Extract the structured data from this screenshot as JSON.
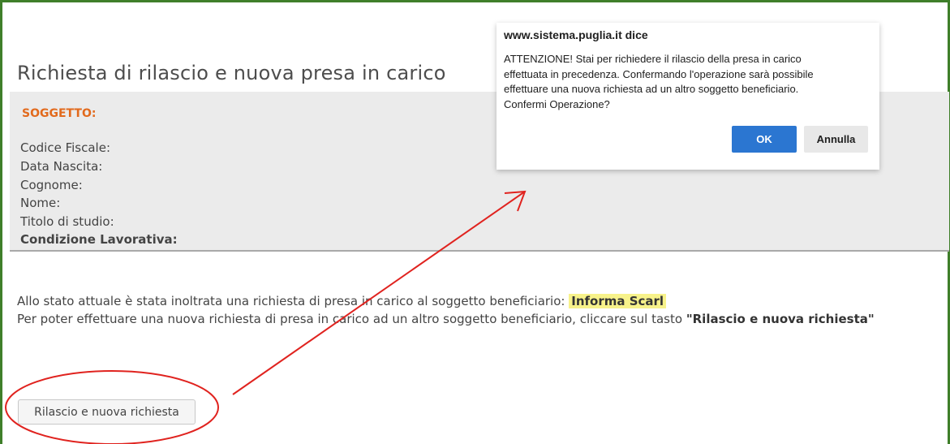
{
  "page": {
    "title": "Richiesta di rilascio e nuova presa in carico"
  },
  "soggetto": {
    "header": "SOGGETTO:",
    "fields": [
      "Codice Fiscale:",
      "Data Nascita:",
      "Cognome:",
      "Nome:",
      "Titolo di studio:",
      "Condizione Lavorativa:"
    ]
  },
  "info": {
    "line1_prefix": "Allo stato attuale è stata inoltrata una richiesta di presa in carico al soggetto beneficiario:",
    "beneficiary": "Informa Scarl",
    "line2_prefix": "Per poter effettuare una nuova richiesta di presa in carico ad un altro soggetto beneficiario, cliccare sul tasto",
    "line2_button_ref": "\"Rilascio e nuova richiesta\""
  },
  "action_button": {
    "label": "Rilascio e nuova richiesta"
  },
  "dialog": {
    "title": "www.sistema.puglia.it dice",
    "message_lines": [
      "ATTENZIONE! Stai per richiedere il rilascio della presa in carico",
      "effettuata in precedenza. Confermando l'operazione sarà possibile",
      "effettuare una nuova richiesta ad un altro soggetto beneficiario.",
      "Confermi Operazione?"
    ],
    "ok_label": "OK",
    "cancel_label": "Annulla"
  },
  "colors": {
    "frame": "#3f7f2a",
    "soggetto_header": "#e26a1d",
    "highlight": "#f7f28a",
    "ok_button": "#2b76d1",
    "annotation": "#e0231f"
  }
}
